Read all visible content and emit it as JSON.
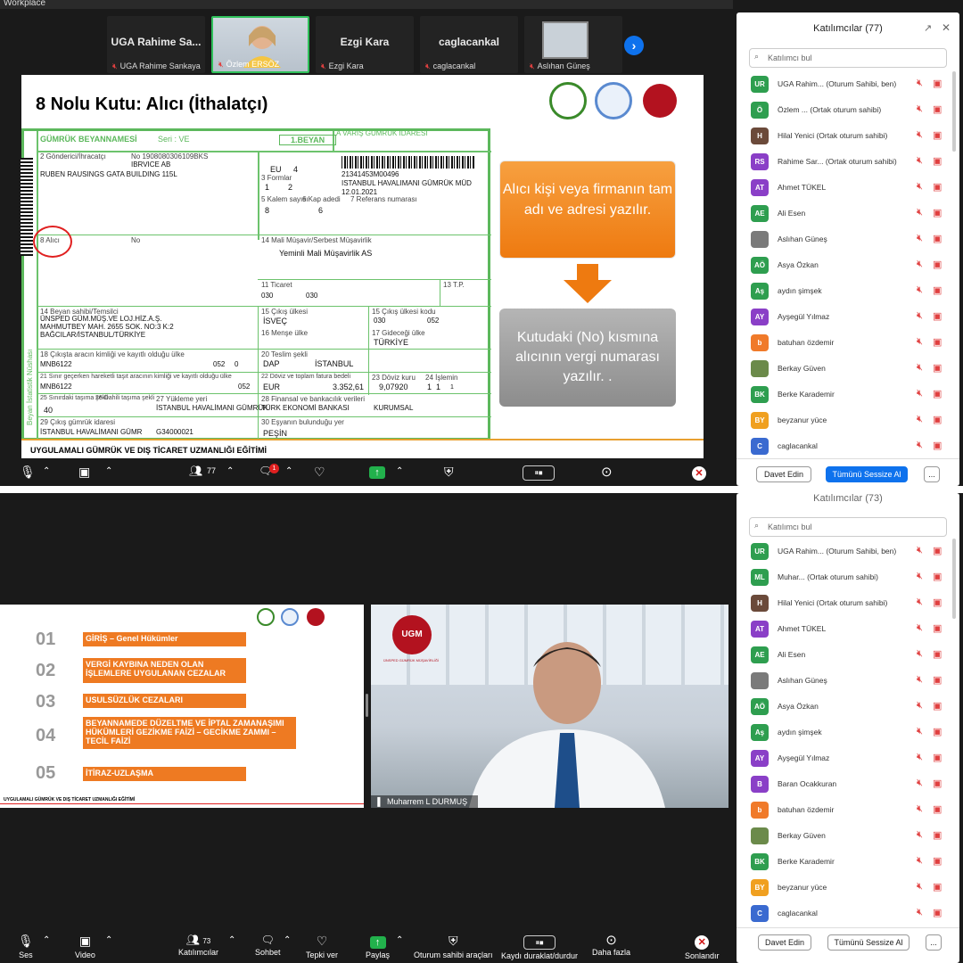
{
  "top": {
    "tab_title": "Workplace",
    "thumbnails": [
      {
        "name": "UGA Rahime Sa...",
        "caption": "UGA Rahime Sankaya"
      },
      {
        "name": "",
        "caption": "Özlem ERSÖZ"
      },
      {
        "name": "Ezgi Kara",
        "caption": "Ezgi Kara"
      },
      {
        "name": "caglacankal",
        "caption": "caglacankal"
      },
      {
        "name": "",
        "caption": "Aslıhan Güneş"
      }
    ],
    "slide": {
      "title": "8 Nolu Kutu: Alıcı (İthalatçı)",
      "orange_box": "Alıcı kişi veya firmanın tam adı ve adresi yazılır.",
      "gray_box": "Kutudaki (No) kısmına alıcının vergi numarası yazılır. .",
      "footer": "UYGULAMALI GÜMRÜK VE DIŞ TİCARET UZMANLIĞI EĞİTİMİ",
      "form": {
        "header": "GÜMRÜK BEYANNAMESİ",
        "seri": "Seri : VE",
        "beyan": "1.BEYAN",
        "varis": "A VARIŞ GÜMRÜK İDARESİ",
        "l_gonderici": "2 Gönderici/İhracatçı",
        "sender_no": "No 1908080306109BKS",
        "sender_name": "IBRVICE AB",
        "sender_addr": "RUBEN RAUSINGS GATA BUILDING 115L",
        "eu": "EU",
        "eu_no": "4",
        "barcode_no": "21341453M00496",
        "office": "ISTANBUL HAVALIMANI GÜMRÜK MÜD",
        "date": "12.01.2021",
        "l_formlar": "3 Formlar",
        "forms_a": "1",
        "forms_b": "2",
        "l_kalem": "5 Kalem sayısı",
        "l_kap": "6 Kap adedi",
        "kalem": "8",
        "kap": "6",
        "l_referans": "7 Referans numarası",
        "l_alici": "8 Alıcı",
        "l_no": "No",
        "l_musavir": "14 Mali Müşavir/Serbest Müşavirlik",
        "musavir": "Yeminli Mali Müşavirlik AS",
        "l_ticaret": "11 Ticaret",
        "val_030a": "030",
        "val_030b": "030",
        "l_tp": "13 T.P.",
        "l_beyan_sahibi": "14 Beyan sahibi/Temsilci",
        "beyan_sahibi": "ÜNSPED GÜM.MÜŞ.VE LOJ.HİZ.A.Ş.",
        "beyan_addr1": "MAHMUTBEY MAH. 2655 SOK. NO:3 K:2",
        "beyan_addr2": "BAĞCILAR/İSTANBUL/TÜRKİYE",
        "l_cikis_ulkesi": "15 Çıkış ülkesi",
        "cikis_ulkesi": "İSVEÇ",
        "l_cikis_kodu": "15 Çıkış ülkesi kodu",
        "cikis_kodu_a": "030",
        "cikis_kodu_b": "052",
        "l_mense": "16 Menşe ülke",
        "l_gidecegi": "17 Gideceği ülke",
        "gidecegi": "TÜRKİYE",
        "l_cikista": "18 Çıkışta aracın kimliği ve kayıtlı olduğu ülke",
        "arac": "MNB6122",
        "arac_kodu": "052",
        "arac_no": "0",
        "l_teslim": "20 Teslim şekli",
        "teslim": "DAP",
        "teslim_yer": "İSTANBUL",
        "l_sinir": "21 Sınır geçerken hareketli taşıt aracının kimliği ve kayıtlı olduğu ülke",
        "sinir_arac": "MNB6122",
        "sinir_kodu": "052",
        "l_doviz": "22 Döviz ve toplam fatura bedeli",
        "doviz": "EUR",
        "tutar": "3.352,61",
        "l_kur": "23 Döviz kuru",
        "kur": "9,07920",
        "l_islem": "24 İşlemin",
        "islem": "1",
        "islem_b": "1",
        "islem_c": "1",
        "l_sinirda": "25 Sınırdaki taşıma şekli",
        "l_dahili": "26 Dahili taşıma şekli",
        "sinirda": "40",
        "l_yukleme": "27 Yükleme yeri",
        "yukleme": "İSTANBUL HAVALİMANI GÜMRÜK",
        "l_finansal": "28 Finansal ve bankacılık verileri",
        "banka": "TÜRK EKONOMİ BANKASI",
        "kurumsal": "KURUMSAL",
        "l_cikis_gumruk": "29 Çıkış gümrük idaresi",
        "cikis_gumruk": "İSTANBUL HAVALİMANI GÜMR",
        "gumruk_kodu": "G34000021",
        "l_esya": "30 Eşyanın bulunduğu yer",
        "esya": "PEŞİN",
        "side_text": "Beyan İstatistik Nüshası"
      }
    },
    "toolbar": {
      "participants": "77",
      "chat_badge": "1"
    }
  },
  "bottom": {
    "slide": {
      "items": [
        {
          "num": "01",
          "text": "GİRİŞ – Genel Hükümler"
        },
        {
          "num": "02",
          "text": "VERGİ KAYBINA NEDEN OLAN İŞLEMLERE UYGULANAN CEZALAR"
        },
        {
          "num": "03",
          "text": "USULSÜZLÜK CEZALARI"
        },
        {
          "num": "04",
          "text": "BEYANNAMEDE DÜZELTME VE İPTAL ZAMANAŞIMI HÜKÜMLERİ GEZİKME FAİZİ – GECİKME ZAMMI – TECİL FAİZİ"
        },
        {
          "num": "05",
          "text": "İTİRAZ-UZLAŞMA"
        }
      ],
      "footer": "UYGULAMALI GÜMRÜK VE DIŞ TİCARET UZMANLIĞI EĞİTİMİ"
    },
    "video": {
      "speaker": "Muharrem L DURMUŞ",
      "logo_text": "UGM",
      "logo_sub": "ÜNSPED GÜMRÜK MÜŞAVİRLİĞİ"
    },
    "toolbar": {
      "ses": "Ses",
      "video": "Video",
      "katilimcilar": "Katılımcılar",
      "katilimci_count": "73",
      "sohbet": "Sohbet",
      "tepki": "Tepki ver",
      "paylas": "Paylaş",
      "sahip": "Oturum sahibi araçları",
      "kayit": "Kaydı duraklat/durdur",
      "fazla": "Daha fazla",
      "sonlandir": "Sonlandır"
    }
  },
  "panel_top": {
    "title": "Katılımcılar (77)",
    "search": "Katılımcı bul",
    "invite": "Davet Edin",
    "mute_all": "Tümünü Sessize Al",
    "more": "...",
    "rows": [
      {
        "init": "UR",
        "color": "#2e9e4f",
        "name": "UGA Rahim... (Oturum Sahibi, ben)"
      },
      {
        "init": "Ö",
        "color": "#2e9e4f",
        "name": "Özlem ... (Ortak oturum sahibi)"
      },
      {
        "init": "H",
        "color": "#6b4a3a",
        "name": "Hilal Yenici (Ortak oturum sahibi)"
      },
      {
        "init": "RS",
        "color": "#8a3fc7",
        "name": "Rahime Sar... (Ortak oturum sahibi)"
      },
      {
        "init": "AT",
        "color": "#8a3fc7",
        "name": "Ahmet TÜKEL"
      },
      {
        "init": "AE",
        "color": "#2e9e4f",
        "name": "Ali Esen"
      },
      {
        "init": "",
        "color": "#7a7a7a",
        "name": "Aslıhan Güneş"
      },
      {
        "init": "AÖ",
        "color": "#2e9e4f",
        "name": "Asya Özkan"
      },
      {
        "init": "Aş",
        "color": "#2e9e4f",
        "name": "aydın şimşek"
      },
      {
        "init": "AY",
        "color": "#8a3fc7",
        "name": "Ayşegül Yılmaz"
      },
      {
        "init": "b",
        "color": "#f07a2a",
        "name": "batuhan özdemir"
      },
      {
        "init": "",
        "color": "#6b8a4a",
        "name": "Berkay Güven"
      },
      {
        "init": "BK",
        "color": "#2e9e4f",
        "name": "Berke Karademir"
      },
      {
        "init": "BY",
        "color": "#f0a020",
        "name": "beyzanur yüce"
      },
      {
        "init": "C",
        "color": "#3a6ad0",
        "name": "caglacankal"
      }
    ]
  },
  "panel_bottom": {
    "title": "Katılımcılar (73)",
    "search": "Katılımcı bul",
    "invite": "Davet Edin",
    "mute_all": "Tümünü Sessize Al",
    "more": "...",
    "rows": [
      {
        "init": "UR",
        "color": "#2e9e4f",
        "name": "UGA Rahim... (Oturum Sahibi, ben)"
      },
      {
        "init": "ML",
        "color": "#2e9e4f",
        "name": "Muhar... (Ortak oturum sahibi)"
      },
      {
        "init": "H",
        "color": "#6b4a3a",
        "name": "Hilal Yenici (Ortak oturum sahibi)"
      },
      {
        "init": "AT",
        "color": "#8a3fc7",
        "name": "Ahmet TÜKEL"
      },
      {
        "init": "AE",
        "color": "#2e9e4f",
        "name": "Ali Esen"
      },
      {
        "init": "",
        "color": "#7a7a7a",
        "name": "Aslıhan Güneş"
      },
      {
        "init": "AÖ",
        "color": "#2e9e4f",
        "name": "Asya Özkan"
      },
      {
        "init": "Aş",
        "color": "#2e9e4f",
        "name": "aydın şimşek"
      },
      {
        "init": "AY",
        "color": "#8a3fc7",
        "name": "Ayşegül Yılmaz"
      },
      {
        "init": "B",
        "color": "#8a3fc7",
        "name": "Baran Ocakkuran"
      },
      {
        "init": "b",
        "color": "#f07a2a",
        "name": "batuhan özdemir"
      },
      {
        "init": "",
        "color": "#6b8a4a",
        "name": "Berkay Güven"
      },
      {
        "init": "BK",
        "color": "#2e9e4f",
        "name": "Berke Karademir"
      },
      {
        "init": "BY",
        "color": "#f0a020",
        "name": "beyzanur yüce"
      },
      {
        "init": "C",
        "color": "#3a6ad0",
        "name": "caglacankal"
      }
    ]
  }
}
